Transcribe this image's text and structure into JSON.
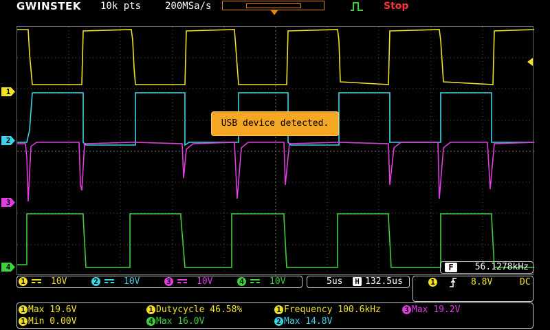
{
  "header": {
    "brand": "GWINSTEK",
    "record_length": "10k pts",
    "sample_rate": "200MSa/s",
    "run_state": "Stop"
  },
  "colors": {
    "ch1": "#f2e12b",
    "ch2": "#3ed4e8",
    "ch3": "#e03ee0",
    "ch4": "#3bd23b",
    "accent": "#e08a00",
    "stop": "#ff3333"
  },
  "channels": [
    {
      "num": "1",
      "coupling_icon": "dc-coupling-icon",
      "scale": "10V"
    },
    {
      "num": "2",
      "coupling_icon": "dc-coupling-icon",
      "scale": "10V"
    },
    {
      "num": "3",
      "coupling_icon": "dc-coupling-icon",
      "scale": "10V"
    },
    {
      "num": "4",
      "coupling_icon": "dc-coupling-icon",
      "scale": "10V"
    }
  ],
  "popup": {
    "message": "USB device detected."
  },
  "frequency_counter": {
    "label": "F",
    "value": "56.1278kHz"
  },
  "timebase": {
    "scale": "5us",
    "h_label": "H",
    "position": "132.5us"
  },
  "trigger": {
    "source": "1",
    "slope_icon": "rising-edge-icon",
    "level": "8.8V",
    "coupling": "DC"
  },
  "measurements": [
    {
      "ch": "1",
      "text": "Max 19.6V"
    },
    {
      "ch": "1",
      "text": "Min 0.00V"
    },
    {
      "ch": "1",
      "text": "Dutycycle 46.58%"
    },
    {
      "ch": "4",
      "text": "Max 16.0V"
    },
    {
      "ch": "1",
      "text": "Frequency 100.6kHz"
    },
    {
      "ch": "2",
      "text": "Max 14.8V"
    },
    {
      "ch": "3",
      "text": "Max 19.2V"
    }
  ]
}
